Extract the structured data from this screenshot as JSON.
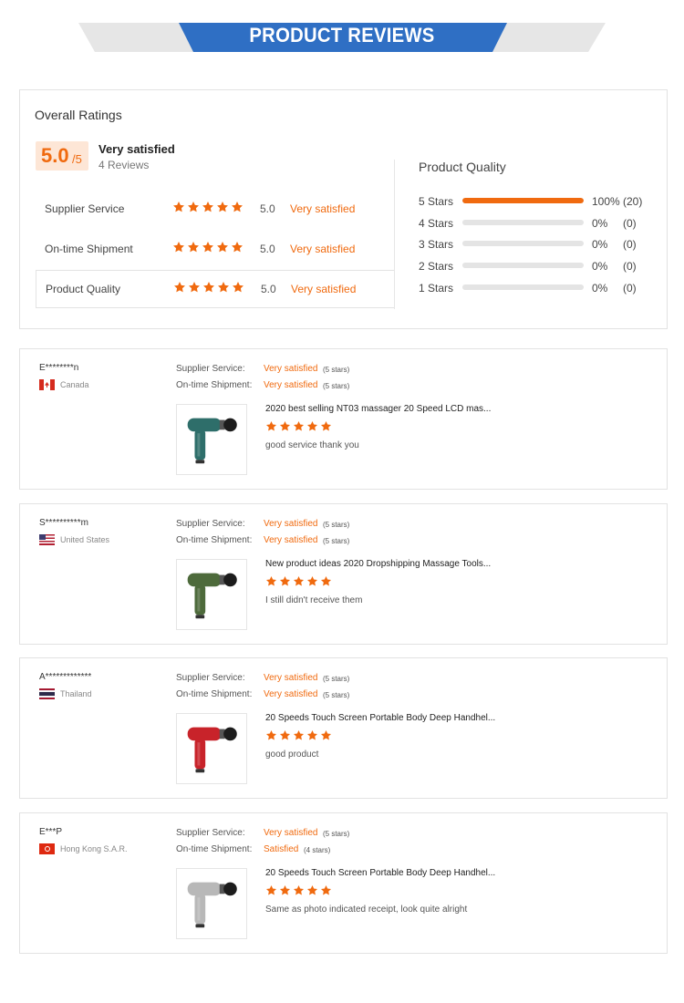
{
  "banner": {
    "title": "PRODUCT REVIEWS",
    "color": "#2f6fc4"
  },
  "overall": {
    "heading": "Overall Ratings",
    "score": "5.0",
    "score_max": "/5",
    "satisfaction": "Very satisfied",
    "review_count": "4 Reviews",
    "categories": [
      {
        "label": "Supplier Service",
        "stars": 5,
        "score": "5.0",
        "text": "Very satisfied"
      },
      {
        "label": "On-time Shipment",
        "stars": 5,
        "score": "5.0",
        "text": "Very satisfied"
      },
      {
        "label": "Product Quality",
        "stars": 5,
        "score": "5.0",
        "text": "Very satisfied"
      }
    ],
    "product_quality": {
      "title": "Product Quality",
      "rows": [
        {
          "label": "5  Stars",
          "percent": 100,
          "percent_text": "100%",
          "count": "(20)"
        },
        {
          "label": "4  Stars",
          "percent": 0,
          "percent_text": "0%",
          "count": "(0)"
        },
        {
          "label": "3  Stars",
          "percent": 0,
          "percent_text": "0%",
          "count": "(0)"
        },
        {
          "label": "2  Stars",
          "percent": 0,
          "percent_text": "0%",
          "count": "(0)"
        },
        {
          "label": "1  Stars",
          "percent": 0,
          "percent_text": "0%",
          "count": "(0)"
        }
      ]
    }
  },
  "accent_color": "#f06a0f",
  "reviews": [
    {
      "user": "E********n",
      "country": "Canada",
      "flag": "flag-canada",
      "supplier_label": "Supplier Service:",
      "supplier_value": "Very satisfied",
      "supplier_stars": "(5 stars)",
      "shipment_label": "On-time Shipment:",
      "shipment_value": "Very satisfied",
      "shipment_stars": "(5 stars)",
      "product": "2020 best selling NT03 massager 20 Speed LCD mas...",
      "rating": 5,
      "comment": "good service thank you",
      "gun_color": "#2e6e6a"
    },
    {
      "user": "S**********m",
      "country": "United States",
      "flag": "flag-usa",
      "supplier_label": "Supplier Service:",
      "supplier_value": "Very satisfied",
      "supplier_stars": "(5 stars)",
      "shipment_label": "On-time Shipment:",
      "shipment_value": "Very satisfied",
      "shipment_stars": "(5 stars)",
      "product": "New product ideas 2020 Dropshipping Massage Tools...",
      "rating": 5,
      "comment": "I still didn't receive them",
      "gun_color": "#4d6a3b"
    },
    {
      "user": "A*************",
      "country": "Thailand",
      "flag": "flag-thailand",
      "supplier_label": "Supplier Service:",
      "supplier_value": "Very satisfied",
      "supplier_stars": "(5 stars)",
      "shipment_label": "On-time Shipment:",
      "shipment_value": "Very satisfied",
      "shipment_stars": "(5 stars)",
      "product": "20 Speeds Touch Screen Portable Body Deep Handhel...",
      "rating": 5,
      "comment": "good product",
      "gun_color": "#c8232a"
    },
    {
      "user": "E***P",
      "country": "Hong Kong S.A.R.",
      "flag": "flag-hongkong",
      "supplier_label": "Supplier Service:",
      "supplier_value": "Very satisfied",
      "supplier_stars": "(5 stars)",
      "shipment_label": "On-time Shipment:",
      "shipment_value": "Satisfied",
      "shipment_stars": "(4 stars)",
      "product": "20 Speeds Touch Screen Portable Body Deep Handhel...",
      "rating": 5,
      "comment": "Same as photo indicated receipt, look quite alright",
      "gun_color": "#b8b8b8"
    }
  ]
}
